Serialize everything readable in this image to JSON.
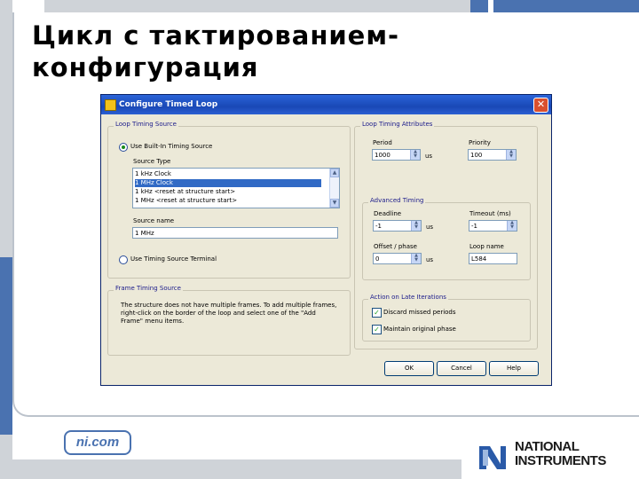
{
  "slide": {
    "title_line1": "Цикл с тактированием-",
    "title_line2": "конфигурация",
    "footer_link": "ni.com",
    "logo_line1": "NATIONAL",
    "logo_line2": "INSTRUMENTS"
  },
  "dialog": {
    "title": "Configure Timed Loop",
    "close_glyph": "✕",
    "loop_timing_source": {
      "group_label": "Loop Timing Source",
      "radio_builtin": "Use Built-In Timing Source",
      "source_type_label": "Source Type",
      "source_types": [
        "1 kHz Clock",
        "1 MHz Clock",
        "1 kHz <reset at structure start>",
        "1 MHz <reset at structure start>"
      ],
      "selected_index": 1,
      "source_name_label": "Source name",
      "source_name_value": "1 MHz",
      "radio_terminal": "Use Timing Source Terminal"
    },
    "frame_timing_source": {
      "group_label": "Frame Timing Source",
      "description": "The structure does not have multiple frames. To add multiple frames, right-click on the border of the loop and select one of the \"Add Frame\" menu items."
    },
    "loop_timing_attributes": {
      "group_label": "Loop Timing Attributes",
      "period_label": "Period",
      "period_value": "1000",
      "period_unit": "us",
      "priority_label": "Priority",
      "priority_value": "100"
    },
    "advanced_timing": {
      "group_label": "Advanced Timing",
      "deadline_label": "Deadline",
      "deadline_value": "-1",
      "deadline_unit": "us",
      "timeout_label": "Timeout (ms)",
      "timeout_value": "-1",
      "offset_label": "Offset / phase",
      "offset_value": "0",
      "offset_unit": "us",
      "loop_name_label": "Loop name",
      "loop_name_value": "L584"
    },
    "late_iterations": {
      "group_label": "Action on Late Iterations",
      "discard_label": "Discard missed periods",
      "maintain_label": "Maintain original phase"
    },
    "buttons": {
      "ok": "OK",
      "cancel": "Cancel",
      "help": "Help"
    }
  }
}
